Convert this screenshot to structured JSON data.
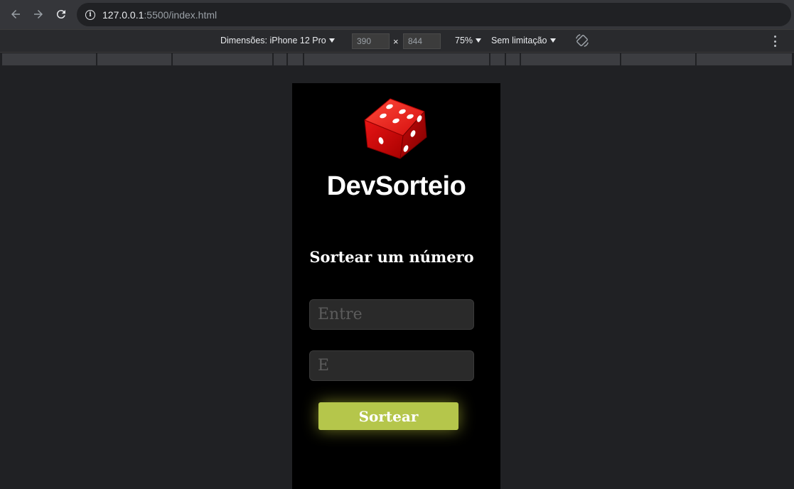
{
  "browser": {
    "url_host": "127.0.0.1",
    "url_rest": ":5500/index.html"
  },
  "device_toolbar": {
    "dimensions_label": "Dimensões: iPhone 12 Pro",
    "width": "390",
    "times": "×",
    "height": "844",
    "zoom": "75%",
    "throttling": "Sem limitação"
  },
  "app": {
    "brand": "DevSorteio",
    "heading": "Sortear um número",
    "inputs": [
      {
        "placeholder": "Entre"
      },
      {
        "placeholder": "E"
      }
    ],
    "button_label": "Sortear",
    "colors": {
      "background": "#000000",
      "button": "#b5c64b",
      "dice": "#e01010"
    }
  }
}
